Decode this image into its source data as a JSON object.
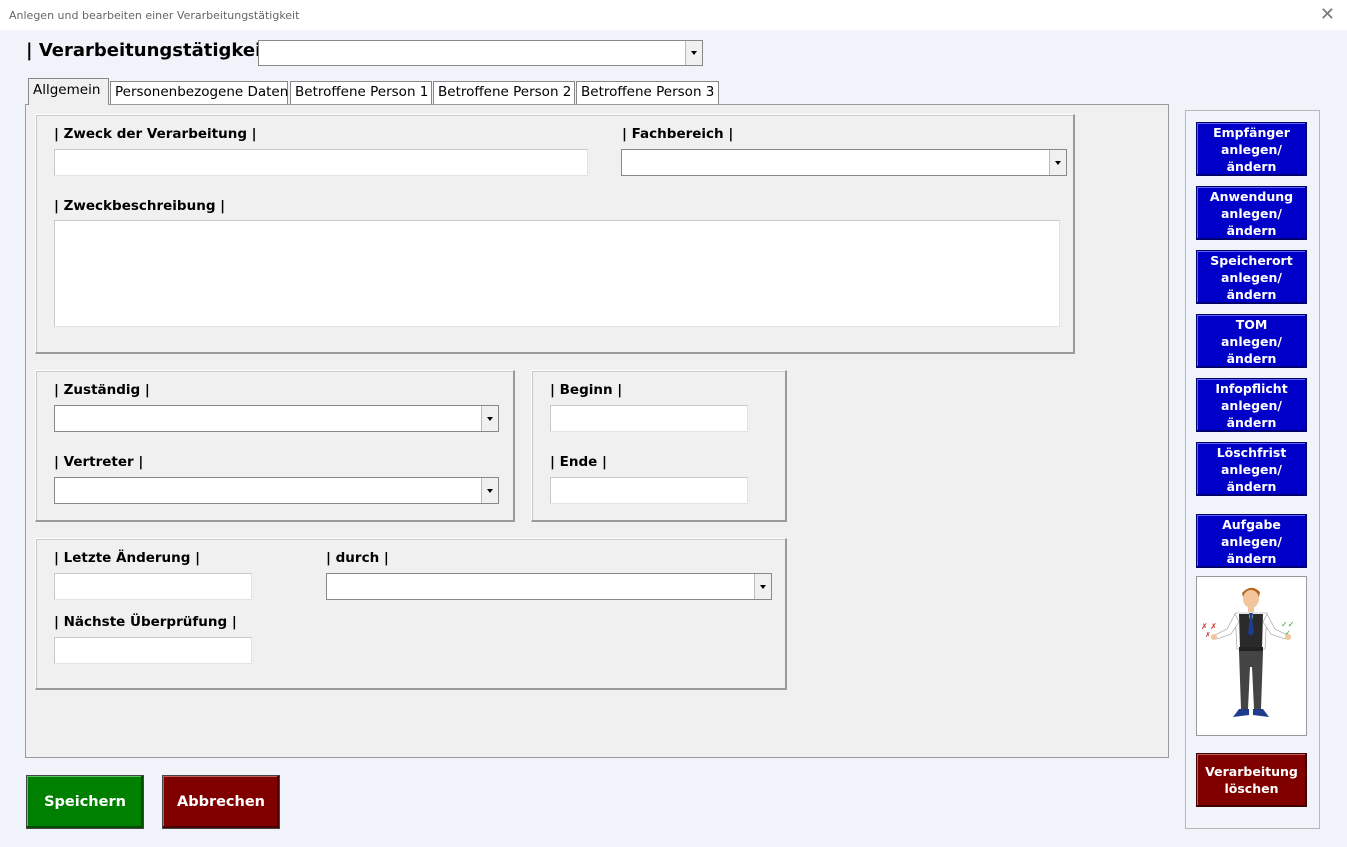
{
  "window": {
    "title": "Anlegen und bearbeiten einer Verarbeitungstätigkeit",
    "close_glyph": "✕"
  },
  "header": {
    "label": "| Verarbeitungstätigkeit |",
    "combo_value": ""
  },
  "tabs": [
    {
      "label": "Allgemein",
      "active": true
    },
    {
      "label": "Personenbezogene Daten",
      "active": false
    },
    {
      "label": "Betroffene Person 1",
      "active": false
    },
    {
      "label": "Betroffene Person 2",
      "active": false
    },
    {
      "label": "Betroffene Person 3",
      "active": false
    }
  ],
  "form": {
    "zweck_label": "| Zweck der Verarbeitung |",
    "zweck_value": "",
    "fachbereich_label": "| Fachbereich |",
    "fachbereich_value": "",
    "zweckbeschreibung_label": "| Zweckbeschreibung |",
    "zweckbeschreibung_value": "",
    "zustaendig_label": "| Zuständig |",
    "zustaendig_value": "",
    "vertreter_label": "| Vertreter |",
    "vertreter_value": "",
    "beginn_label": "| Beginn |",
    "beginn_value": "",
    "ende_label": "| Ende |",
    "ende_value": "",
    "letzte_aenderung_label": "| Letzte Änderung |",
    "letzte_aenderung_value": "",
    "durch_label": "| durch |",
    "durch_value": "",
    "naechste_pruefung_label": "| Nächste Überprüfung |",
    "naechste_pruefung_value": ""
  },
  "side_buttons": [
    {
      "line1": "Empfänger",
      "line2": "anlegen/ändern"
    },
    {
      "line1": "Anwendung",
      "line2": "anlegen/ändern"
    },
    {
      "line1": "Speicherort",
      "line2": "anlegen/ändern"
    },
    {
      "line1": "TOM",
      "line2": "anlegen/ändern"
    },
    {
      "line1": "Infopflicht",
      "line2": "anlegen/ändern"
    },
    {
      "line1": "Löschfrist",
      "line2": "anlegen/ändern"
    },
    {
      "line1": "Aufgabe",
      "line2": "anlegen/ändern"
    }
  ],
  "delete_button": {
    "line1": "Verarbeitung",
    "line2": "löschen"
  },
  "footer": {
    "save_label": "Speichern",
    "cancel_label": "Abbrechen"
  },
  "colors": {
    "side_button": "#0000c8",
    "delete_button": "#800000",
    "save_button": "#008000",
    "cancel_button": "#800000"
  },
  "icons": {
    "illustration": "businessman-figure"
  }
}
